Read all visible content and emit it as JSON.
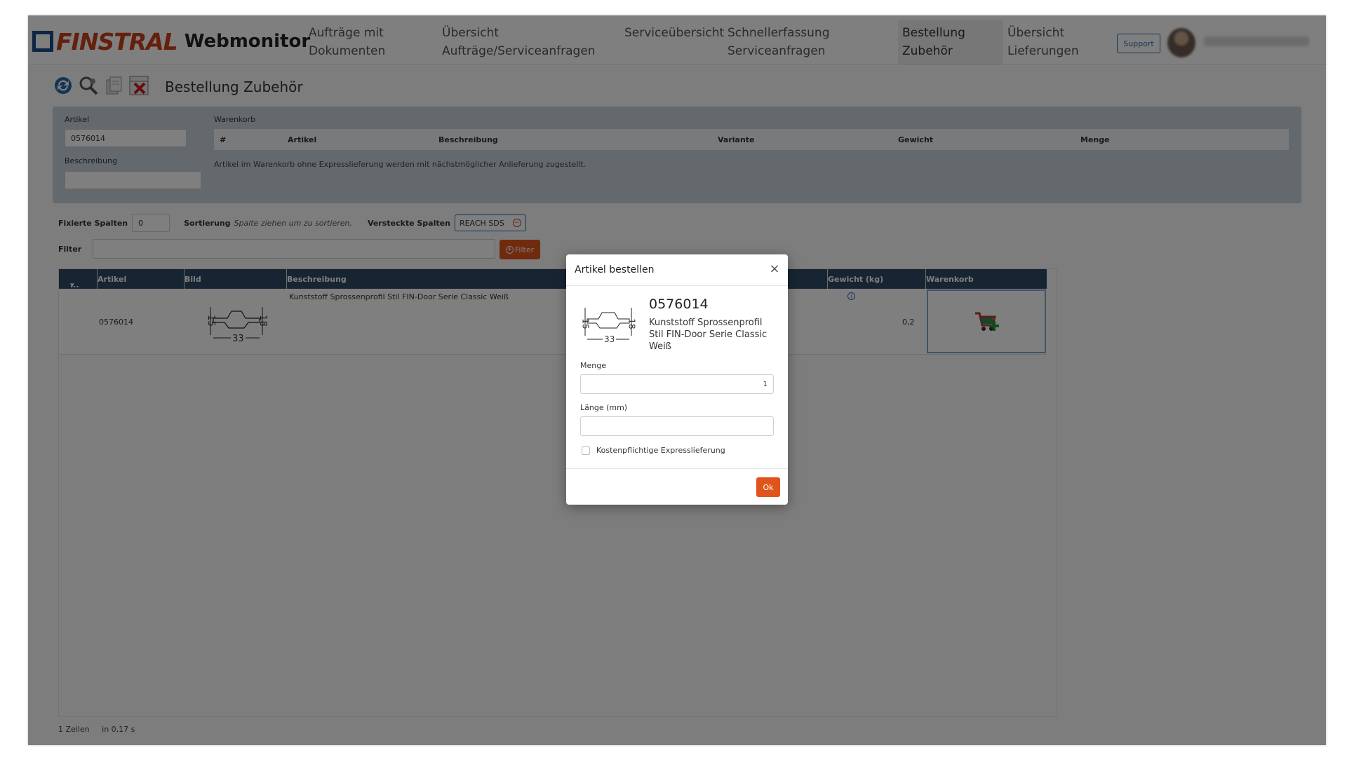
{
  "header": {
    "logo_brand": "FINSTRAL",
    "logo_app": "Webmonitor",
    "nav": [
      {
        "label1": "Aufträge mit",
        "label2": "Dokumenten"
      },
      {
        "label1": "Übersicht",
        "label2": "Aufträge/Serviceanfragen"
      },
      {
        "label1": "Serviceübersicht",
        "label2": ""
      },
      {
        "label1": "Schnellerfassung",
        "label2": "Serviceanfragen"
      },
      {
        "label1": "Bestellung",
        "label2": "Zubehör"
      },
      {
        "label1": "Übersicht",
        "label2": "Lieferungen"
      }
    ],
    "support_label": "Support"
  },
  "page": {
    "title": "Bestellung Zubehör",
    "toolbar_icons": [
      "refresh-icon",
      "search-settings-icon",
      "copy-document-icon",
      "delete-icon"
    ]
  },
  "search_panel": {
    "artikel_label": "Artikel",
    "artikel_value": "0576014",
    "beschreibung_label": "Beschreibung",
    "beschreibung_value": "",
    "warenkorb_label": "Warenkorb",
    "cart_columns": [
      "#",
      "Artikel",
      "Beschreibung",
      "Variante",
      "Gewicht",
      "Menge"
    ],
    "cart_note": "Artikel im Warenkorb ohne Expresslieferung werden mit nächstmöglicher Anlieferung zugestellt."
  },
  "options": {
    "fixed_cols_label": "Fixierte Spalten",
    "fixed_cols_value": "0",
    "sort_label": "Sortierung",
    "sort_hint": "Spalte ziehen um zu sortieren.",
    "hidden_cols_label": "Versteckte Spalten",
    "hidden_cols_tag": "REACH SDS",
    "filter_label": "Filter",
    "filter_button": "Filter"
  },
  "grid": {
    "columns": [
      "...",
      "Artikel",
      "Bild",
      "Beschreibung",
      "Gewicht (kg)",
      "Warenkorb"
    ],
    "row": {
      "artikel": "0576014",
      "beschreibung": "Kunststoff Sprossenprofil Stil FIN-Door Serie Classic Weiß",
      "gewicht": "0,2",
      "dim_left": "15",
      "dim_right": "18",
      "dim_bottom": "33"
    }
  },
  "status": {
    "rows": "1 Zeilen",
    "time": "in 0,17 s"
  },
  "modal": {
    "title": "Artikel bestellen",
    "artno": "0576014",
    "description": "Kunststoff Sprossenprofil Stil FIN-Door Serie Classic Weiß",
    "menge_label": "Menge",
    "menge_value": "1",
    "laenge_label": "Länge (mm)",
    "laenge_value": "",
    "express_label": "Kostenpflichtige Expresslieferung",
    "ok_label": "Ok"
  },
  "colors": {
    "accent": "#e0541c",
    "brand_red": "#c8411a",
    "brand_blue": "#1f4a8c",
    "grid_header": "#2f4a66"
  }
}
